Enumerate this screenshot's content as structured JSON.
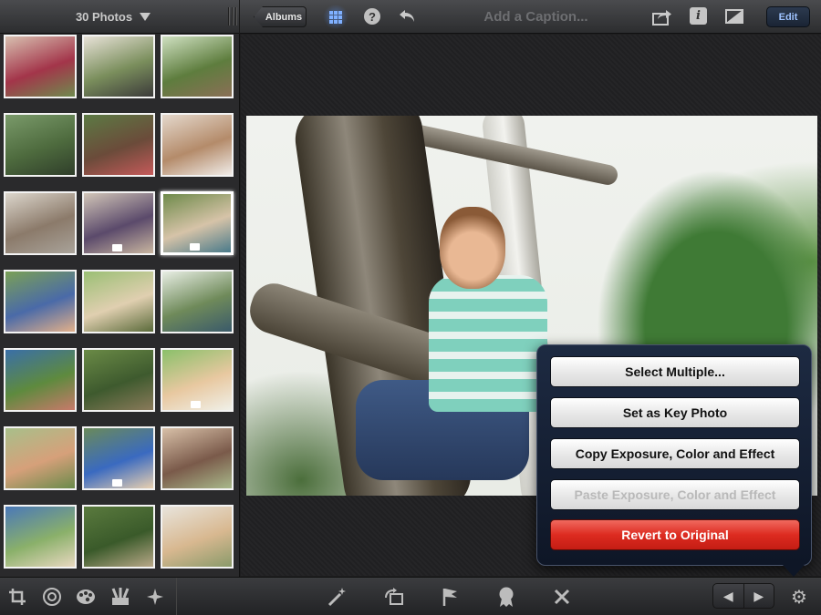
{
  "topbar": {
    "photos_count": "30 Photos",
    "albums_label": "Albums",
    "help_label": "?",
    "caption_placeholder": "Add a Caption...",
    "info_label": "i",
    "edit_label": "Edit"
  },
  "thumbnails": [
    {
      "name": "thumb-1",
      "colors": [
        "#d8c0b0",
        "#a3354a",
        "#6f8a4e"
      ]
    },
    {
      "name": "thumb-2",
      "colors": [
        "#e8e2d8",
        "#7a8e5c",
        "#3b3a3a"
      ]
    },
    {
      "name": "thumb-3",
      "colors": [
        "#cfe0c1",
        "#5e7d3e",
        "#8a6f56"
      ]
    },
    {
      "name": "thumb-4",
      "colors": [
        "#7a9a6a",
        "#4e6b3e",
        "#2f3e2a"
      ]
    },
    {
      "name": "thumb-5",
      "colors": [
        "#5c7a44",
        "#6b4b3a",
        "#c55a5a"
      ]
    },
    {
      "name": "thumb-6",
      "colors": [
        "#e4d8cc",
        "#b48b6a",
        "#f0ece8"
      ]
    },
    {
      "name": "thumb-7",
      "colors": [
        "#dcd6cc",
        "#8b7a6a",
        "#a9a39a"
      ]
    },
    {
      "name": "thumb-8",
      "colors": [
        "#d2c6b8",
        "#5b4a6b",
        "#c9b6a0"
      ]
    },
    {
      "name": "thumb-9",
      "colors": [
        "#6e8a4a",
        "#d6c3a8",
        "#4a7a8a"
      ]
    },
    {
      "name": "thumb-10",
      "colors": [
        "#7aa056",
        "#4a6aa8",
        "#e2b08a"
      ]
    },
    {
      "name": "thumb-11",
      "colors": [
        "#9abf74",
        "#e0cfb0",
        "#5a6a3a"
      ]
    },
    {
      "name": "thumb-12",
      "colors": [
        "#e8eee4",
        "#6f8a5a",
        "#3a5a6a"
      ]
    },
    {
      "name": "thumb-13",
      "colors": [
        "#3a6fa8",
        "#5e8a3e",
        "#c87a6a"
      ]
    },
    {
      "name": "thumb-14",
      "colors": [
        "#6a8a46",
        "#3e5a2e",
        "#8a7a5a"
      ]
    },
    {
      "name": "thumb-15",
      "colors": [
        "#8ac06a",
        "#e8c8a0",
        "#f0f0e8"
      ]
    },
    {
      "name": "thumb-16",
      "colors": [
        "#a8bf8a",
        "#d6a07a",
        "#6a8a4a"
      ]
    },
    {
      "name": "thumb-17",
      "colors": [
        "#6a8a5a",
        "#3a6ac0",
        "#e8d0b0"
      ]
    },
    {
      "name": "thumb-18",
      "colors": [
        "#d8c0a8",
        "#7a5a4a",
        "#a8b88a"
      ]
    },
    {
      "name": "thumb-19",
      "colors": [
        "#4a78b8",
        "#8ab06a",
        "#e8d8c0"
      ]
    },
    {
      "name": "thumb-20",
      "colors": [
        "#5a7a3e",
        "#3a5a2a",
        "#b8a888"
      ]
    },
    {
      "name": "thumb-21",
      "colors": [
        "#e8e4dc",
        "#d8b890",
        "#8a9a6a"
      ]
    }
  ],
  "popover": {
    "items": [
      {
        "label": "Select Multiple...",
        "state": "normal"
      },
      {
        "label": "Set as Key Photo",
        "state": "normal"
      },
      {
        "label": "Copy Exposure, Color and Effect",
        "state": "normal"
      },
      {
        "label": "Paste Exposure, Color and Effect",
        "state": "disabled"
      },
      {
        "label": "Revert to Original",
        "state": "danger"
      }
    ]
  },
  "bottombar": {
    "left_tools": [
      "crop-icon",
      "exposure-icon",
      "color-palette-icon",
      "brushes-icon",
      "effects-icon"
    ],
    "center_tools": [
      "auto-enhance-icon",
      "rotate-icon",
      "flag-icon",
      "favorite-badge-icon",
      "hide-x-icon"
    ],
    "prev_glyph": "◀",
    "next_glyph": "▶",
    "settings_glyph": "⚙"
  }
}
